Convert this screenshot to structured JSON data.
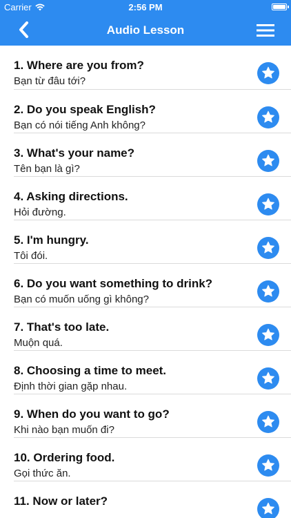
{
  "status": {
    "carrier": "Carrier",
    "time": "2:56 PM",
    "battery_level": 1.0
  },
  "nav": {
    "title": "Audio Lesson",
    "back_icon": "chevron-left-icon",
    "menu_icon": "hamburger-menu-icon"
  },
  "colors": {
    "accent": "#2d8bf0",
    "divider": "#dadada"
  },
  "lessons": [
    {
      "title": "1. Where are you from?",
      "subtitle": "Bạn từ đâu tới?",
      "icon": "star-icon"
    },
    {
      "title": "2. Do you speak English?",
      "subtitle": "Bạn có nói tiếng Anh không?",
      "icon": "star-icon"
    },
    {
      "title": "3. What's your name?",
      "subtitle": "Tên bạn là gì?",
      "icon": "star-icon"
    },
    {
      "title": "4. Asking directions.",
      "subtitle": "Hỏi đường.",
      "icon": "star-icon"
    },
    {
      "title": "5. I'm hungry.",
      "subtitle": "Tôi đói.",
      "icon": "star-icon"
    },
    {
      "title": "6. Do you want something to drink?",
      "subtitle": "Bạn có muốn uống gì không?",
      "icon": "star-icon"
    },
    {
      "title": "7. That's too late.",
      "subtitle": "Muộn quá.",
      "icon": "star-icon"
    },
    {
      "title": "8. Choosing a time to meet.",
      "subtitle": "Định thời gian gặp nhau.",
      "icon": "star-icon"
    },
    {
      "title": "9. When do you want to go?",
      "subtitle": "Khi nào bạn muốn đi?",
      "icon": "star-icon"
    },
    {
      "title": "10. Ordering food.",
      "subtitle": "Gọi thức ăn.",
      "icon": "star-icon"
    },
    {
      "title": "11. Now or later?",
      "subtitle": "",
      "icon": "star-icon"
    }
  ]
}
